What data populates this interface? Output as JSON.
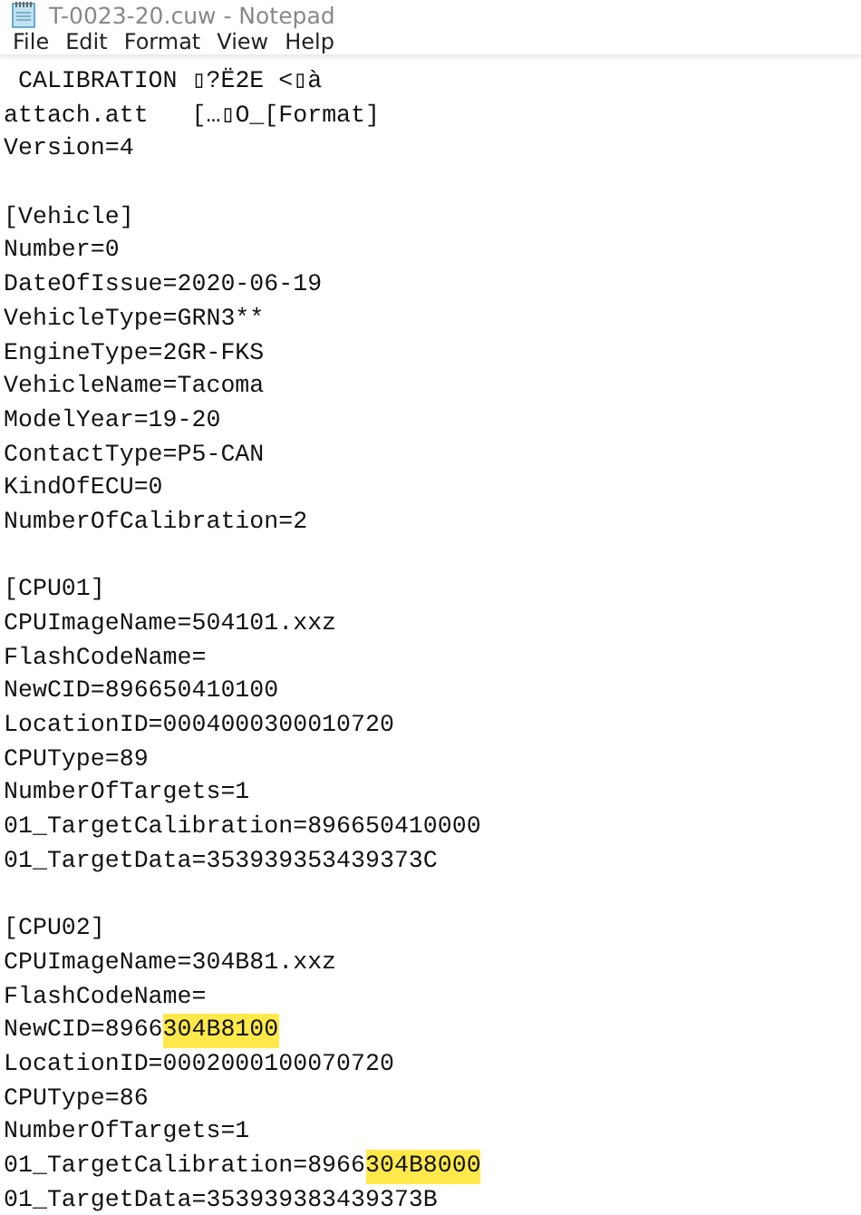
{
  "window": {
    "title": "T-0023-20.cuw - Notepad"
  },
  "menu": [
    "File",
    "Edit",
    "Format",
    "View",
    "Help"
  ],
  "lines": [
    {
      "kind": "text",
      "segments": [
        {
          "text": " CALIBRATION ▯?Ë2E <▯à",
          "highlighted": false
        }
      ]
    },
    {
      "kind": "text",
      "segments": [
        {
          "text": "attach.att   […▯O_[Format]",
          "highlighted": false
        }
      ]
    },
    {
      "kind": "text",
      "segments": [
        {
          "text": "Version=4",
          "highlighted": false
        }
      ]
    },
    {
      "kind": "blank"
    },
    {
      "kind": "text",
      "segments": [
        {
          "text": "[Vehicle]",
          "highlighted": false
        }
      ]
    },
    {
      "kind": "text",
      "segments": [
        {
          "text": "Number=0",
          "highlighted": false
        }
      ]
    },
    {
      "kind": "text",
      "segments": [
        {
          "text": "DateOfIssue=2020-06-19",
          "highlighted": false
        }
      ]
    },
    {
      "kind": "text",
      "segments": [
        {
          "text": "VehicleType=GRN3**",
          "highlighted": false
        }
      ]
    },
    {
      "kind": "text",
      "segments": [
        {
          "text": "EngineType=2GR-FKS",
          "highlighted": false
        }
      ]
    },
    {
      "kind": "text",
      "segments": [
        {
          "text": "VehicleName=Tacoma",
          "highlighted": false
        }
      ]
    },
    {
      "kind": "text",
      "segments": [
        {
          "text": "ModelYear=19-20",
          "highlighted": false
        }
      ]
    },
    {
      "kind": "text",
      "segments": [
        {
          "text": "ContactType=P5-CAN",
          "highlighted": false
        }
      ]
    },
    {
      "kind": "text",
      "segments": [
        {
          "text": "KindOfECU=0",
          "highlighted": false
        }
      ]
    },
    {
      "kind": "text",
      "segments": [
        {
          "text": "NumberOfCalibration=2",
          "highlighted": false
        }
      ]
    },
    {
      "kind": "blank"
    },
    {
      "kind": "text",
      "segments": [
        {
          "text": "[CPU01]",
          "highlighted": false
        }
      ]
    },
    {
      "kind": "text",
      "segments": [
        {
          "text": "CPUImageName=504101.xxz",
          "highlighted": false
        }
      ]
    },
    {
      "kind": "text",
      "segments": [
        {
          "text": "FlashCodeName=",
          "highlighted": false
        }
      ]
    },
    {
      "kind": "text",
      "segments": [
        {
          "text": "NewCID=896650410100",
          "highlighted": false
        }
      ]
    },
    {
      "kind": "text",
      "segments": [
        {
          "text": "LocationID=0004000300010720",
          "highlighted": false
        }
      ]
    },
    {
      "kind": "text",
      "segments": [
        {
          "text": "CPUType=89",
          "highlighted": false
        }
      ]
    },
    {
      "kind": "text",
      "segments": [
        {
          "text": "NumberOfTargets=1",
          "highlighted": false
        }
      ]
    },
    {
      "kind": "text",
      "segments": [
        {
          "text": "01_TargetCalibration=896650410000",
          "highlighted": false
        }
      ]
    },
    {
      "kind": "text",
      "segments": [
        {
          "text": "01_TargetData=353939353439373C",
          "highlighted": false
        }
      ]
    },
    {
      "kind": "blank"
    },
    {
      "kind": "text",
      "segments": [
        {
          "text": "[CPU02]",
          "highlighted": false
        }
      ]
    },
    {
      "kind": "text",
      "segments": [
        {
          "text": "CPUImageName=304B81.xxz",
          "highlighted": false
        }
      ]
    },
    {
      "kind": "text",
      "segments": [
        {
          "text": "FlashCodeName=",
          "highlighted": false
        }
      ]
    },
    {
      "kind": "text",
      "segments": [
        {
          "text": "NewCID=8966",
          "highlighted": false
        },
        {
          "text": "304B8100",
          "highlighted": true
        }
      ]
    },
    {
      "kind": "text",
      "segments": [
        {
          "text": "LocationID=0002000100070720",
          "highlighted": false
        }
      ]
    },
    {
      "kind": "text",
      "segments": [
        {
          "text": "CPUType=86",
          "highlighted": false
        }
      ]
    },
    {
      "kind": "text",
      "segments": [
        {
          "text": "NumberOfTargets=1",
          "highlighted": false
        }
      ]
    },
    {
      "kind": "text",
      "segments": [
        {
          "text": "01_TargetCalibration=8966",
          "highlighted": false
        },
        {
          "text": "304B8000",
          "highlighted": true
        }
      ]
    },
    {
      "kind": "text",
      "segments": [
        {
          "text": "01_TargetData=353939383439373B",
          "highlighted": false
        }
      ]
    }
  ]
}
